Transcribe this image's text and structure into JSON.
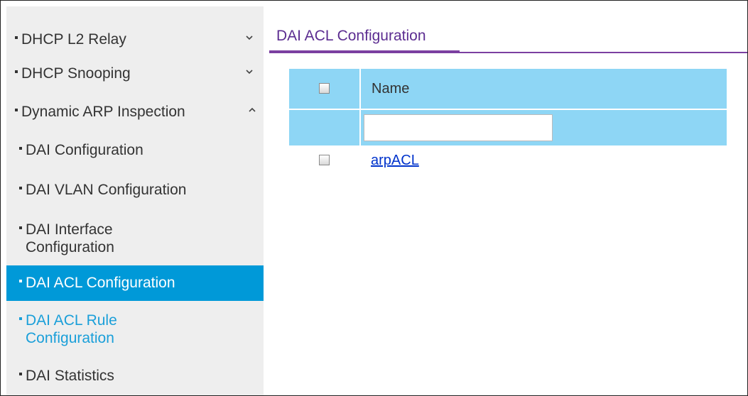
{
  "sidebar": {
    "items": [
      {
        "label": "DHCP L2 Relay",
        "chevron": "chevron-down-icon"
      },
      {
        "label": "DHCP Snooping",
        "chevron": "chevron-down-icon"
      },
      {
        "label": "Dynamic ARP Inspection",
        "chevron": "chevron-up-icon"
      },
      {
        "label": "DAI Configuration"
      },
      {
        "label": "DAI VLAN Configuration"
      },
      {
        "label_line1": "DAI Interface",
        "label_line2": "Configuration"
      },
      {
        "label": "DAI ACL Configuration",
        "state": "active"
      },
      {
        "label_line1": "DAI ACL Rule",
        "label_line2": "Configuration",
        "state": "link"
      },
      {
        "label": "DAI Statistics"
      }
    ]
  },
  "main": {
    "tab_title": "DAI ACL Configuration",
    "table": {
      "header_name": "Name",
      "filter_value": "",
      "rows": [
        {
          "name": "arpACL",
          "checked": false
        }
      ]
    }
  },
  "colors": {
    "sidebar_bg": "#eeeeee",
    "active_bg": "#0099d8",
    "link_text": "#1a9fd9",
    "tab_accent": "#7b3fa0",
    "table_header_bg": "#8ed6f5",
    "row_link": "#0033cc"
  }
}
